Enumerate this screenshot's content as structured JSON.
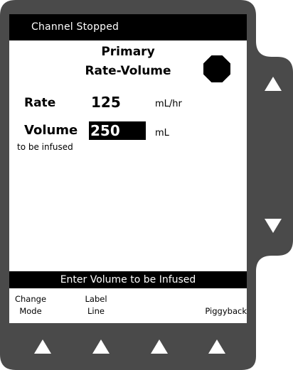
{
  "screen": {
    "status": "Channel Stopped",
    "title_line1": "Primary",
    "title_line2": "Rate-Volume",
    "stop_indicator_icon": "stop-octagon-icon",
    "rate": {
      "label": "Rate",
      "value": "125",
      "unit": "mL/hr"
    },
    "volume": {
      "label": "Volume",
      "value": "250",
      "unit": "mL",
      "sublabel": "to be infused"
    },
    "prompt": "Enter Volume to be Infused",
    "softkeys": [
      {
        "line1": "Change",
        "line2": "Mode"
      },
      {
        "line1": "Label",
        "line2": "Line"
      },
      {
        "line1": "",
        "line2": ""
      },
      {
        "line1": "",
        "line2": "Piggyback"
      }
    ]
  },
  "side_buttons": {
    "up_icon": "up-arrow-icon",
    "down_icon": "down-arrow-icon"
  },
  "bottom_buttons": [
    "up-arrow-icon",
    "up-arrow-icon",
    "up-arrow-icon",
    "up-arrow-icon"
  ],
  "colors": {
    "bezel": "#4a4a4a",
    "screen": "#ffffff",
    "text": "#000000"
  }
}
